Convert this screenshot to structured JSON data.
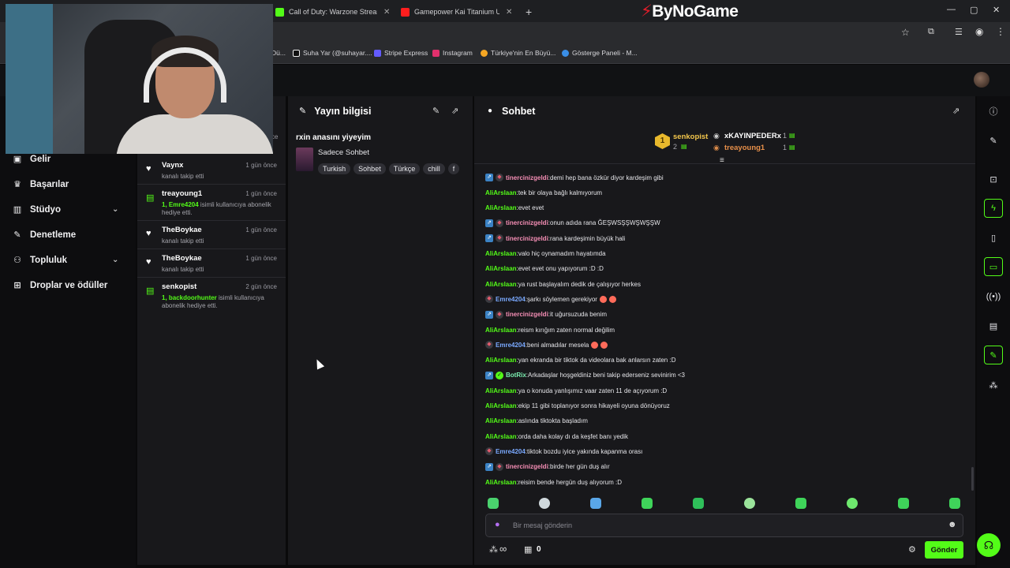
{
  "browser": {
    "tabs": [
      {
        "title": "Call of Duty: Warzone Streamin"
      },
      {
        "title": "Gamepower Kai Titanium Ultra"
      }
    ],
    "brand": "ByNoGame",
    "bookmarks": [
      {
        "label": "Dü..."
      },
      {
        "label": "Suha Yar (@suhayar...."
      },
      {
        "label": "Stripe Express"
      },
      {
        "label": "Instagram"
      },
      {
        "label": "Türkiye'nin En Büyü..."
      },
      {
        "label": "Gösterge Paneli - M..."
      }
    ]
  },
  "sidebar": {
    "items": [
      {
        "label": "Gelir",
        "icon": "money-icon"
      },
      {
        "label": "Başarılar",
        "icon": "trophy-icon"
      },
      {
        "label": "Stüdyo",
        "icon": "studio-icon",
        "expandable": true
      },
      {
        "label": "Denetleme",
        "icon": "wrench-icon"
      },
      {
        "label": "Topluluk",
        "icon": "community-icon",
        "expandable": true
      },
      {
        "label": "Droplar ve ödüller",
        "icon": "drops-icon"
      }
    ]
  },
  "activity": {
    "items": [
      {
        "name": "Vaynx",
        "time": "1 gün önce",
        "text": "kanalı takip etti",
        "type": "follow"
      },
      {
        "name": "treayoung1",
        "time": "1 gün önce",
        "highlight": "1, Emre4204",
        "text": " isimli kullanıcıya abonelik hediye etti.",
        "type": "gift"
      },
      {
        "name": "TheBoykae",
        "time": "1 gün önce",
        "text": "kanalı takip etti",
        "type": "follow"
      },
      {
        "name": "TheBoykae",
        "time": "1 gün önce",
        "text": "kanalı takip etti",
        "type": "follow"
      },
      {
        "name": "senkopist",
        "time": "2 gün önce",
        "highlight": "1, backdoorhunter",
        "text": " isimli kullanıcıya abonelik hediye etti.",
        "type": "gift"
      }
    ],
    "partial_label": "ce"
  },
  "stream_info": {
    "panel_title": "Yayın bilgisi",
    "title": "rxin anasını yiyeyim",
    "category": "Sadece Sohbet",
    "tags": [
      "Turkish",
      "Sohbet",
      "Türkçe",
      "chill",
      "f"
    ]
  },
  "chat": {
    "panel_title": "Sohbet",
    "leaderboard": {
      "first": {
        "rank": "1",
        "name": "senkopist",
        "count": "2"
      },
      "others": [
        {
          "name": "xKAYINPEDERx",
          "count": "1"
        },
        {
          "name": "treayoung1",
          "count": "1"
        }
      ]
    },
    "messages": [
      {
        "user": "tinercinizgeldi",
        "color": "pink",
        "badges": [
          "blue",
          "shield"
        ],
        "text": "demi hep bana özkür diyor kardeşim gibi"
      },
      {
        "user": "AliArslaan",
        "color": "green",
        "badges": [],
        "text": "tek bir olaya bağlı kalmıyorum"
      },
      {
        "user": "AliArslaan",
        "color": "green",
        "badges": [],
        "text": "evet evet"
      },
      {
        "user": "tinercinizgeldi",
        "color": "pink",
        "badges": [
          "blue",
          "shield"
        ],
        "text": "onun adıda rana ĞEŞWSŞŞWŞWŞŞW"
      },
      {
        "user": "tinercinizgeldi",
        "color": "pink",
        "badges": [
          "blue",
          "shield"
        ],
        "text": "rana kardeşimin büyük hali"
      },
      {
        "user": "AliArslaan",
        "color": "green",
        "badges": [],
        "text": "valo hiç oynamadım hayatımda"
      },
      {
        "user": "AliArslaan",
        "color": "green",
        "badges": [],
        "text": "evet evet onu yapıyorum :D :D"
      },
      {
        "user": "AliArslaan",
        "color": "green",
        "badges": [],
        "text": "ya rust başlayalım dedik de çalışıyor herkes"
      },
      {
        "user": "Emre4204",
        "color": "blue",
        "badges": [
          "shield"
        ],
        "text": "şarkı söylemen gerekiyor",
        "emotes": 2
      },
      {
        "user": "tinercinizgeldi",
        "color": "pink",
        "badges": [
          "blue",
          "shield"
        ],
        "text": "it uğursuzuda benim"
      },
      {
        "user": "AliArslaan",
        "color": "green",
        "badges": [],
        "text": "reism kırığım zaten normal değilim"
      },
      {
        "user": "Emre4204",
        "color": "blue",
        "badges": [
          "shield"
        ],
        "text": "beni almadılar mesela",
        "emotes": 2
      },
      {
        "user": "AliArslaan",
        "color": "green",
        "badges": [],
        "text": "yan ekranda bir tiktok da videolara bak anlarsın zaten :D"
      },
      {
        "user": "BotRix",
        "color": "teal",
        "badges": [
          "blue",
          "check"
        ],
        "text": "Arkadaşlar hoşgeldiniz beni takip ederseniz sevinirim <3"
      },
      {
        "user": "AliArslaan",
        "color": "green",
        "badges": [],
        "text": "ya o konuda yanlışımız vaar zaten 11 de açıyorum :D"
      },
      {
        "user": "AliArslaan",
        "color": "green",
        "badges": [],
        "text": "ekip 11 gibi toplanıyor sonra hikayeli oyuna dönüyoruz"
      },
      {
        "user": "AliArslaan",
        "color": "green",
        "badges": [],
        "text": "aslında tiktokta başladım"
      },
      {
        "user": "AliArslaan",
        "color": "green",
        "badges": [],
        "text": "orda daha kolay dı da keşfet banı yedik"
      },
      {
        "user": "Emre4204",
        "color": "blue",
        "badges": [
          "shield"
        ],
        "text": "tiktok bozdu iyice yakında kapanma orası"
      },
      {
        "user": "tinercinizgeldi",
        "color": "pink",
        "badges": [
          "blue",
          "shield"
        ],
        "text": "birde her gün duş alır"
      },
      {
        "user": "AliArslaan",
        "color": "green",
        "badges": [],
        "text": "reisim bende hergün duş alıyorum :D"
      }
    ],
    "input_placeholder": "Bir mesaj gönderin",
    "infinity_label": "∞",
    "gift_count": "0",
    "send_label": "Gönder"
  },
  "colors": {
    "accent": "#53fc18",
    "panel": "#18181b",
    "bg": "#0a0a0b"
  }
}
